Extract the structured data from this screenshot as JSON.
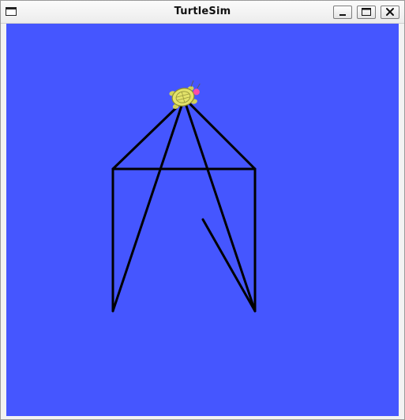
{
  "window": {
    "title": "TurtleSim",
    "menu_icon": "window-menu-icon",
    "controls": [
      "minimize-icon",
      "maximize-icon",
      "close-icon"
    ]
  },
  "canvas": {
    "background_color": "#4556ff",
    "pen_color": "#000000"
  },
  "turtle": {
    "icon": "turtle-icon",
    "shell_color": "#e3e36a",
    "head_color": "#ff4da6"
  }
}
